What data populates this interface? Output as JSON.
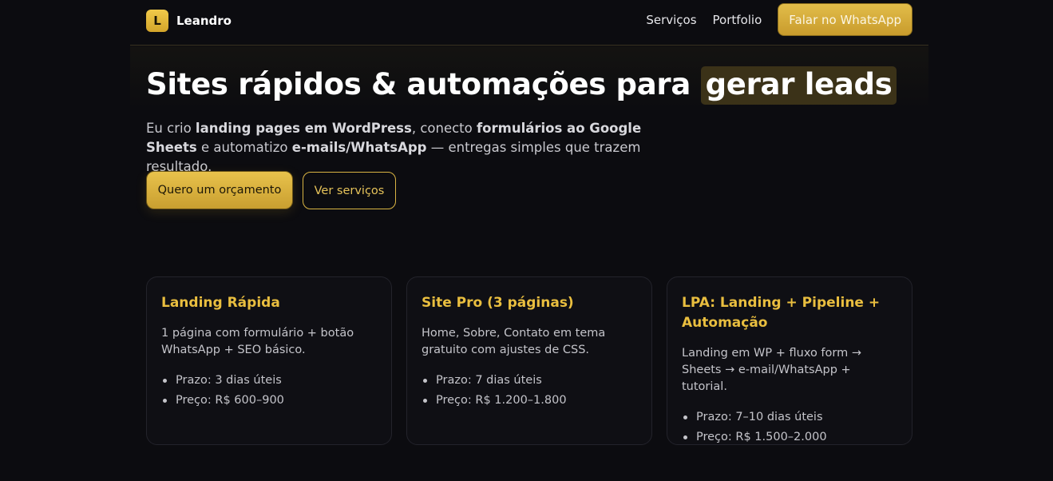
{
  "header": {
    "logo_letter": "L",
    "brand": "Leandro",
    "nav": [
      "Serviços",
      "Portfolio"
    ],
    "cta": "Falar no WhatsApp"
  },
  "hero": {
    "title_main": "Sites rápidos & automações para ",
    "title_highlight": "gerar leads",
    "sub": {
      "p1": "Eu crio ",
      "b1": "landing pages em WordPress",
      "p2": ", conecto ",
      "b2": "formulários ao Google Sheets",
      "p3": " e automatizo ",
      "b3": "e-mails/WhatsApp",
      "p4": " — entregas simples que trazem resultado."
    },
    "primary_button": "Quero um orçamento",
    "secondary_button": "Ver serviços"
  },
  "cards": [
    {
      "title": "Landing Rápida",
      "desc": "1 página com formulário + botão WhatsApp + SEO básico.",
      "items": [
        "Prazo: 3 dias úteis",
        "Preço: R$ 600–900"
      ]
    },
    {
      "title": "Site Pro (3 páginas)",
      "desc": "Home, Sobre, Contato em tema gratuito com ajustes de CSS.",
      "items": [
        "Prazo: 7 dias úteis",
        "Preço: R$ 1.200–1.800"
      ]
    },
    {
      "title": "LPA: Landing + Pipeline + Automação",
      "desc": "Landing em WP + fluxo form → Sheets → e-mail/WhatsApp + tutorial.",
      "items": [
        "Prazo: 7–10 dias úteis",
        "Preço: R$ 1.500–2.000"
      ]
    }
  ],
  "colors": {
    "background": "#0c0c10",
    "accent": "#e9be3f",
    "card_bg": "#0f0f14"
  }
}
